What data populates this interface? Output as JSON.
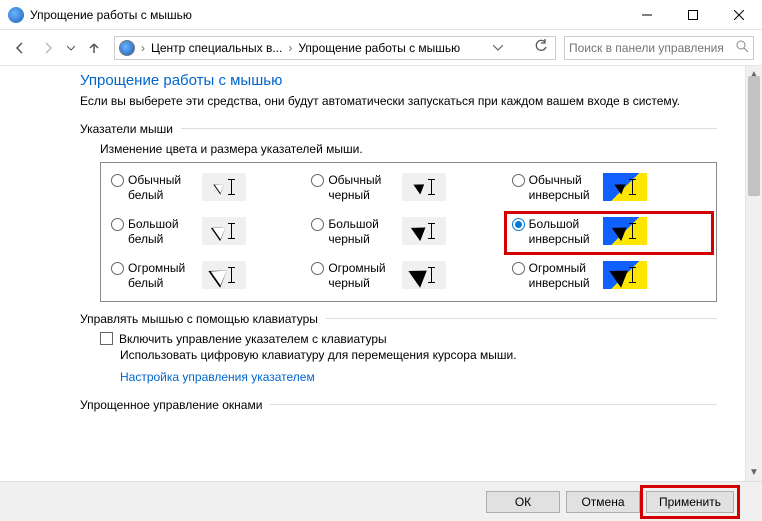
{
  "window": {
    "title": "Упрощение работы с мышью"
  },
  "nav": {
    "crumb1": "Центр специальных в...",
    "crumb2": "Упрощение работы с мышью",
    "search_placeholder": "Поиск в панели управления"
  },
  "main": {
    "heading": "Упрощение работы с мышью",
    "description": "Если вы выберете эти средства, они будут автоматически запускаться при каждом вашем входе в систему."
  },
  "pointers": {
    "section_label": "Указатели мыши",
    "sub_heading": "Изменение цвета и размера указателей мыши.",
    "options": {
      "o0": "Обычный белый",
      "o1": "Обычный черный",
      "o2": "Обычный инверсный",
      "o3": "Большой белый",
      "o4": "Большой черный",
      "o5": "Большой инверсный",
      "o6": "Огромный белый",
      "o7": "Огромный черный",
      "o8": "Огромный инверсный"
    },
    "selected": "o5"
  },
  "keyboard": {
    "section_label": "Управлять мышью с помощью клавиатуры",
    "checkbox_label": "Включить управление указателем с клавиатуры",
    "helper": "Использовать цифровую клавиатуру для перемещения курсора мыши.",
    "link": "Настройка управления указателем"
  },
  "windows": {
    "section_label": "Упрощенное управление окнами"
  },
  "footer": {
    "ok": "ОК",
    "cancel": "Отмена",
    "apply": "Применить"
  }
}
